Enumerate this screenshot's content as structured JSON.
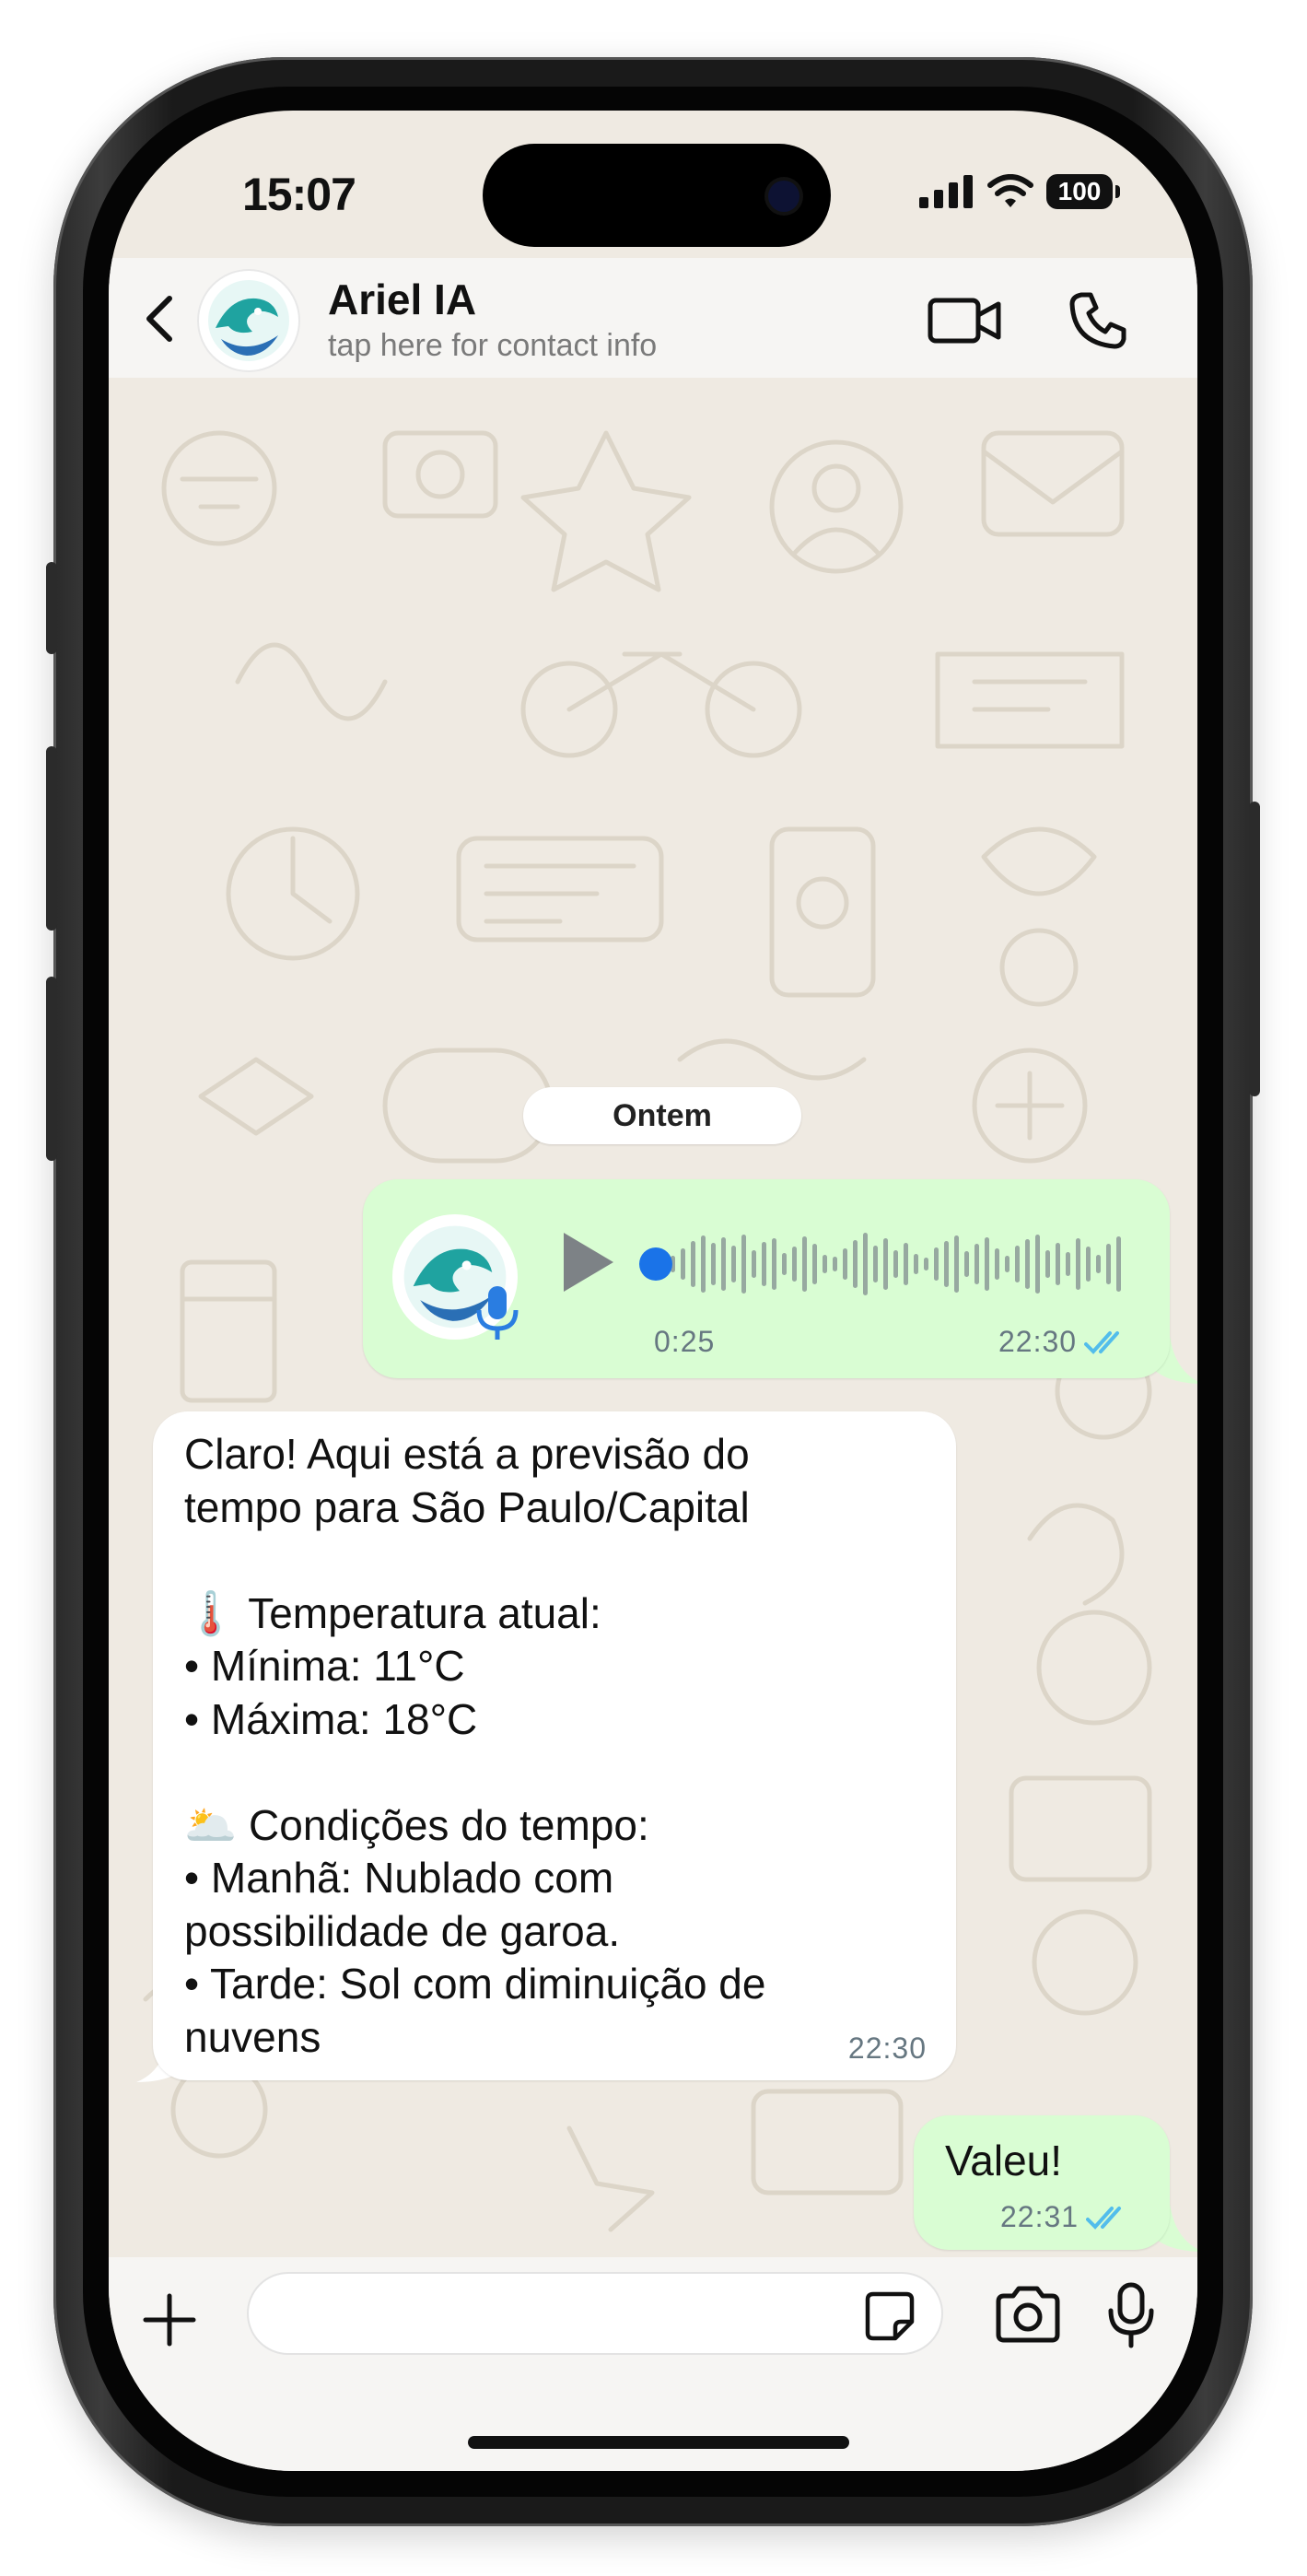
{
  "status_bar": {
    "time": "15:07",
    "battery": "100"
  },
  "header": {
    "contact_name": "Ariel IA",
    "contact_subtitle": "tap here for contact info",
    "icons": [
      "back-chevron-icon",
      "video-call-icon",
      "phone-icon"
    ]
  },
  "chat": {
    "date_label": "Ontem",
    "voice_message": {
      "duration": "0:25",
      "time": "22:30",
      "status": "read",
      "progress": 0
    },
    "incoming_message": {
      "text": "Claro! Aqui está a previsão do\ntempo para São Paulo/Capital\n\n🌡️ Temperatura atual:\n•  Mínima: 11°C\n•  Máxima: 18°C\n\n🌥️ Condições do tempo:\n•  Manhã: Nublado com\npossibilidade de garoa.\n•  Tarde: Sol com diminuição de\nnuvens",
      "time": "22:30"
    },
    "reply_message": {
      "text": "Valeu!",
      "time": "22:31",
      "status": "read"
    }
  },
  "input_bar": {
    "placeholder": "",
    "icons": [
      "plus-icon",
      "sticker-icon",
      "camera-icon",
      "microphone-icon"
    ]
  },
  "colors": {
    "outgoing_bubble": "#d9fdd3",
    "incoming_bubble": "#ffffff",
    "read_ticks": "#53bdeb",
    "chat_background": "#efeae2",
    "voice_progress_dot": "#1a73e8"
  }
}
